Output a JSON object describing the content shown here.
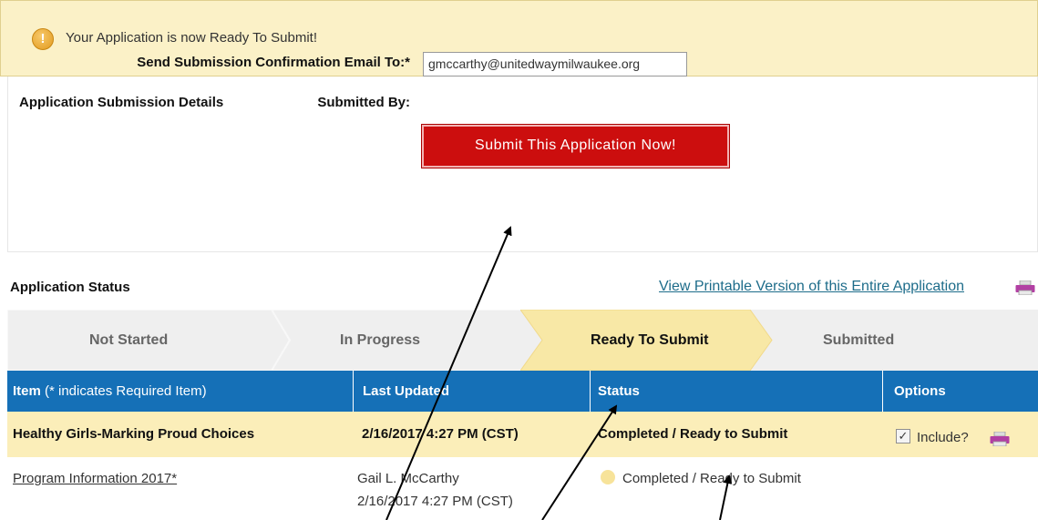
{
  "alert": {
    "message": "Your Application is now Ready To Submit!",
    "icon": "warning-icon",
    "color": "#fbf1c7"
  },
  "details": {
    "title": "Application Submission Details",
    "email_label": "Send Submission Confirmation Email To:*",
    "email_value": "gmccarthy@unitedwaymilwaukee.org",
    "submitted_by_label": "Submitted By:",
    "submitted_by_value": "",
    "submit_button": "Submit This Application Now!",
    "submit_color": "#cc0e0e"
  },
  "status": {
    "title": "Application Status",
    "print_link": "View Printable Version of this Entire Application",
    "steps": [
      "Not Started",
      "In Progress",
      "Ready To Submit",
      "Submitted"
    ],
    "active_step": "Ready To Submit"
  },
  "table": {
    "headers": {
      "item_bold": "Item",
      "item_note": " (* indicates Required Item)",
      "last_updated": "Last Updated",
      "status": "Status",
      "options": "Options"
    },
    "header_color": "#1570b7",
    "summary_row": {
      "item": "Healthy Girls-Marking Proud Choices",
      "last_updated": "2/16/2017 4:27 PM (CST)",
      "status": "Completed / Ready to Submit",
      "include_label": "Include?",
      "include_checked": true
    },
    "rows": [
      {
        "item": "Program Information 2017*",
        "updated_by": "Gail L. McCarthy",
        "updated_at": "2/16/2017 4:27 PM (CST)",
        "status": "Completed / Ready to Submit"
      }
    ]
  }
}
